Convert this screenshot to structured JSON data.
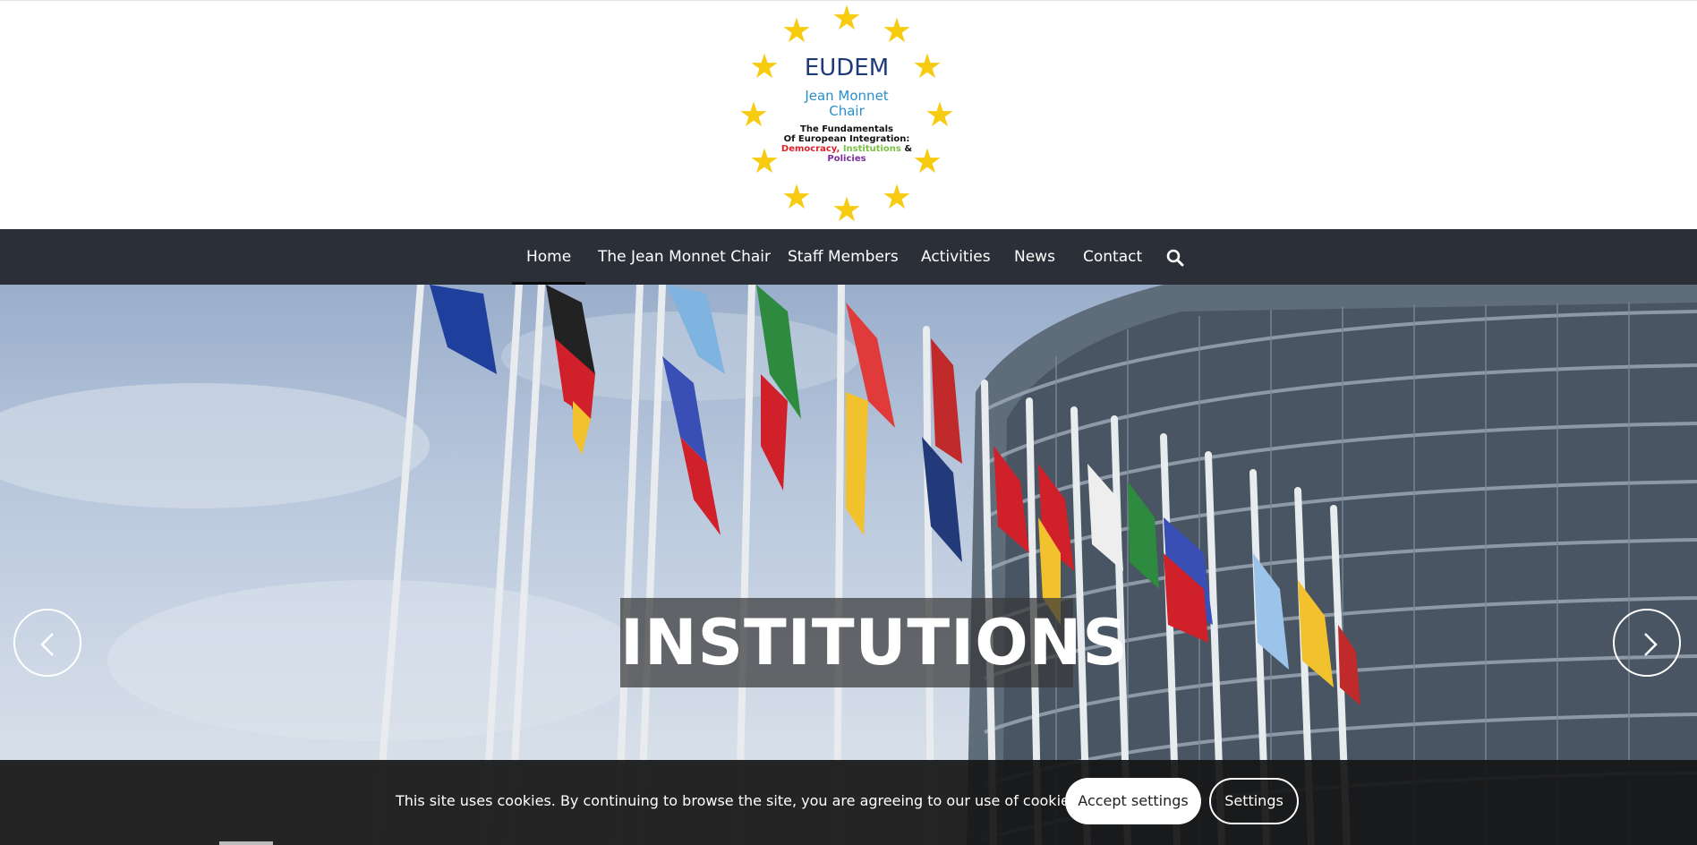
{
  "logo": {
    "title": "EUDEM",
    "subtitle_line1": "Jean Monnet",
    "subtitle_line2": "Chair",
    "tagline_line1": "The Fundamentals",
    "tagline_line2": "Of European Integration:",
    "tagline_democracy": "Democracy,",
    "tagline_institutions": "Institutions",
    "tagline_amp": "&",
    "tagline_policies": "Policies",
    "star_color": "#f7cc10"
  },
  "nav": {
    "items": [
      {
        "label": "Home",
        "active": true
      },
      {
        "label": "The Jean Monnet Chair",
        "active": false
      },
      {
        "label": "Staff Members",
        "active": false
      },
      {
        "label": "Activities",
        "active": false
      },
      {
        "label": "News",
        "active": false
      },
      {
        "label": "Contact",
        "active": false
      }
    ],
    "search_icon": "search-icon",
    "background": "#2b3038"
  },
  "hero": {
    "caption": "INSTITUTIONS",
    "prev_icon": "chevron-left-icon",
    "next_icon": "chevron-right-icon"
  },
  "cookie": {
    "text": "This site uses cookies. By continuing to browse the site, you are agreeing to our use of cookies.",
    "accept_label": "Accept settings",
    "settings_label": "Settings"
  }
}
